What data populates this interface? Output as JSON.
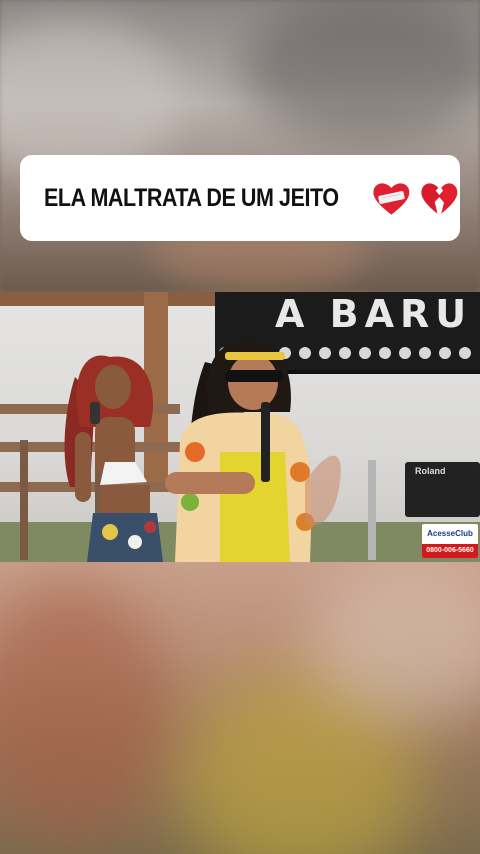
{
  "caption": {
    "text": "ELA MALTRATA DE UM JEITO",
    "emoji_1": "mending-heart-icon",
    "emoji_2": "broken-heart-icon"
  },
  "video": {
    "sign_text": "A BARU",
    "keyboard_brand": "Roland",
    "watermark": {
      "name": "AcesseClub",
      "phone": "0800-006-5660"
    }
  },
  "colors": {
    "caption_bg": "#ffffff",
    "caption_text": "#111111",
    "heart_red": "#e0202e",
    "watermark_red": "#d11b1b"
  }
}
